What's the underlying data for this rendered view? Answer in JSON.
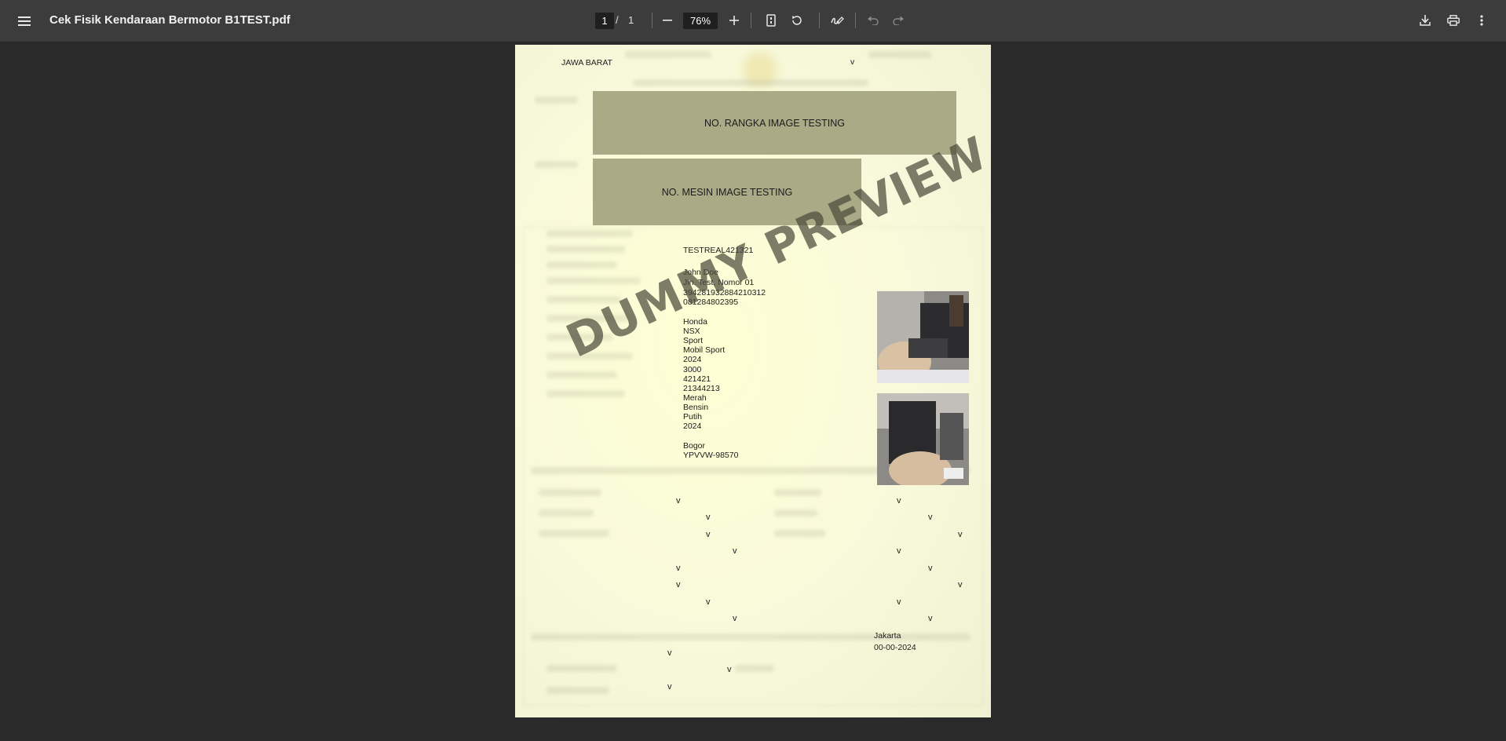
{
  "toolbar": {
    "title": "Cek Fisik Kendaraan Bermotor B1TEST.pdf",
    "page_current": "1",
    "page_separator": "/",
    "page_total": "1",
    "zoom": "76%",
    "icons": [
      "menu-icon",
      "zoom-out-icon",
      "zoom-in-icon",
      "fit-page-icon",
      "rotate-icon",
      "annotate-icon",
      "undo-icon",
      "redo-icon",
      "download-icon",
      "print-icon",
      "more-vert-icon"
    ]
  },
  "document": {
    "province": "JAWA BARAT",
    "top_check": "v",
    "rangka_box": "NO. RANGKA IMAGE TESTING",
    "mesin_box": "NO. MESIN IMAGE TESTING",
    "registration": "TESTREAL421321",
    "owner_lines": [
      "John Doe",
      "Jln. Test, Nomor 01",
      "394281932884210312",
      "081284802395"
    ],
    "vehicle_lines": [
      "Honda",
      "NSX",
      "Sport",
      "Mobil Sport",
      "2024",
      "3000",
      "421421",
      "21344213",
      "Merah",
      "Bensin",
      "Putih",
      "2024"
    ],
    "location_lines": [
      "Bogor",
      "YPVVW-98570"
    ],
    "watermark": "DUMMY PREVIEW",
    "checkmarks": [
      "v",
      "v",
      "v",
      "v",
      "v",
      "v",
      "v",
      "v",
      "v",
      "v",
      "v",
      "v",
      "v",
      "v",
      "v",
      "v",
      "v",
      "v",
      "v",
      "v"
    ],
    "sign_city": "Jakarta",
    "sign_date": "00-00-2024"
  }
}
